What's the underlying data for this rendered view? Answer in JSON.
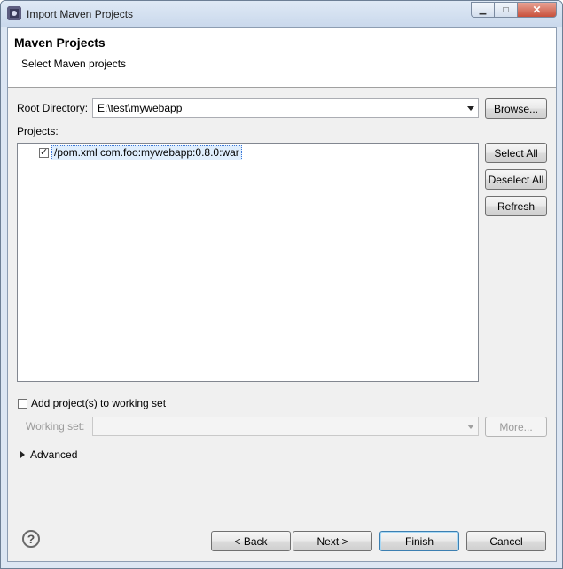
{
  "window": {
    "title": "Import Maven Projects",
    "icon": "eclipse-icon"
  },
  "header": {
    "title": "Maven Projects",
    "subtitle": "Select Maven projects"
  },
  "root_directory": {
    "label": "Root Directory:",
    "value": "E:\\test\\mywebapp",
    "browse_label": "Browse..."
  },
  "projects": {
    "label": "Projects:",
    "items": [
      {
        "checked": true,
        "label": "/pom.xml  com.foo:mywebapp:0.8.0:war"
      }
    ],
    "select_all_label": "Select All",
    "deselect_all_label": "Deselect All",
    "refresh_label": "Refresh"
  },
  "working_set": {
    "checkbox_label": "Add project(s) to working set",
    "checked": false,
    "label": "Working set:",
    "value": "",
    "more_label": "More..."
  },
  "advanced": {
    "label": "Advanced",
    "expanded": false
  },
  "footer": {
    "back_label": "< Back",
    "next_label": "Next >",
    "finish_label": "Finish",
    "cancel_label": "Cancel"
  }
}
